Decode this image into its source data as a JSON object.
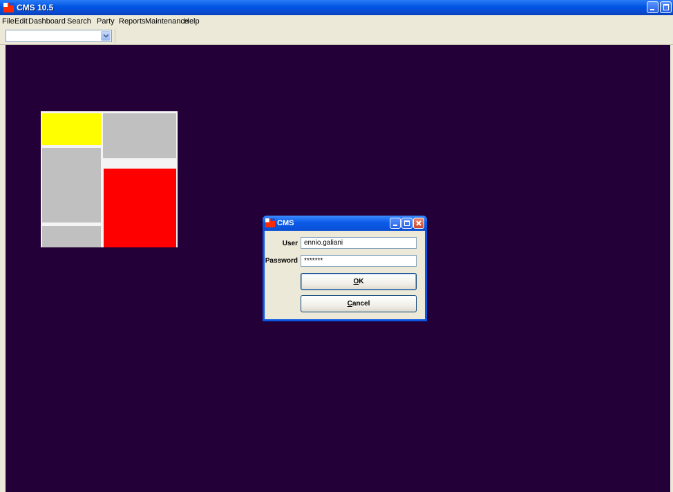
{
  "app": {
    "title": "CMS 10.5"
  },
  "menu": [
    "File",
    "Edit",
    "Dashboard",
    "Search",
    "Party",
    "Reports",
    "Maintenance",
    "Help"
  ],
  "toolbar": {
    "combo_value": ""
  },
  "treemap": {
    "tiles": [
      {
        "name": "tile-yellow",
        "color": "#ffff00"
      },
      {
        "name": "tile-gray-top-right",
        "color": "#c0c0c0"
      },
      {
        "name": "tile-gray-mid-left",
        "color": "#c0c0c0"
      },
      {
        "name": "tile-red",
        "color": "#ff0000"
      },
      {
        "name": "tile-gray-bottom-left",
        "color": "#c0c0c0"
      }
    ]
  },
  "dialog": {
    "title": "CMS",
    "user_label": "User",
    "user_value": "ennio.galiani",
    "password_label": "Password",
    "password_value": "*******",
    "ok_mnemonic": "O",
    "ok_rest": "K",
    "cancel_mnemonic": "C",
    "cancel_rest": "ancel"
  },
  "colors": {
    "workspace": "#230038",
    "titlebar": "#0054e3",
    "window_face": "#ece9d8"
  }
}
